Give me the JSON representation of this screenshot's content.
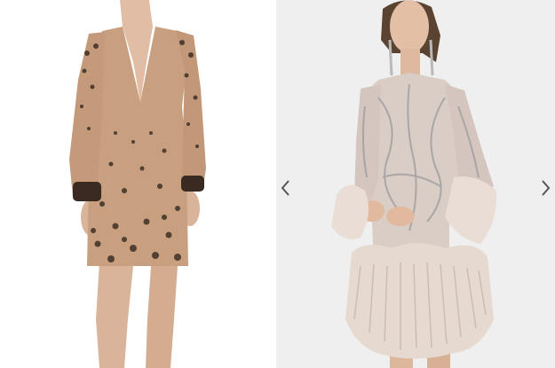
{
  "carousel": {
    "images": [
      {
        "name": "sequin-plunge-mini-dress"
      },
      {
        "name": "embellished-feather-mini-dress"
      }
    ],
    "prev_icon": "chevron-left-icon",
    "next_icon": "chevron-right-icon",
    "arrow_color": "#555555"
  }
}
